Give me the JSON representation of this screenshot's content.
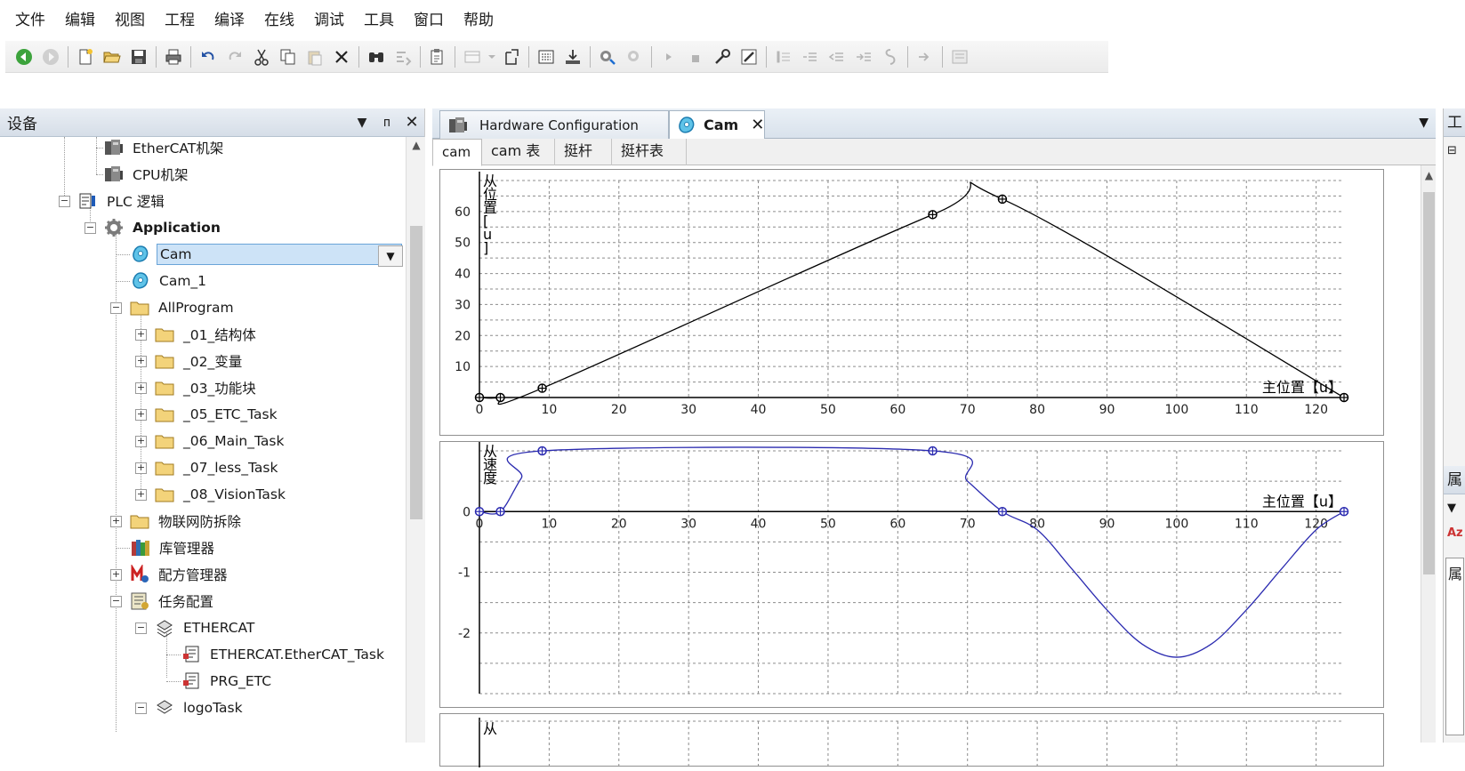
{
  "menu": [
    "文件",
    "编辑",
    "视图",
    "工程",
    "编译",
    "在线",
    "调试",
    "工具",
    "窗口",
    "帮助"
  ],
  "device_panel": {
    "title": "设备",
    "tree": [
      {
        "label": "EtherCAT机架",
        "icon": "rack-icon"
      },
      {
        "label": "CPU机架",
        "icon": "rack-icon"
      },
      {
        "label": "PLC 逻辑",
        "icon": "plc-logic-icon"
      },
      {
        "label": "Application",
        "icon": "application-gear-icon"
      },
      {
        "label": "Cam",
        "icon": "cam-icon"
      },
      {
        "label": "Cam_1",
        "icon": "cam-icon"
      },
      {
        "label": "AllProgram",
        "icon": "folder-icon"
      },
      {
        "label": "_01_结构体",
        "icon": "folder-icon"
      },
      {
        "label": "_02_变量",
        "icon": "folder-icon"
      },
      {
        "label": "_03_功能块",
        "icon": "folder-icon"
      },
      {
        "label": "_05_ETC_Task",
        "icon": "folder-icon"
      },
      {
        "label": "_06_Main_Task",
        "icon": "folder-icon"
      },
      {
        "label": "_07_less_Task",
        "icon": "folder-icon"
      },
      {
        "label": "_08_VisionTask",
        "icon": "folder-icon"
      },
      {
        "label": "物联网防拆除",
        "icon": "folder-icon"
      },
      {
        "label": "库管理器",
        "icon": "library-icon"
      },
      {
        "label": "配方管理器",
        "icon": "recipe-icon"
      },
      {
        "label": "任务配置",
        "icon": "task-config-icon"
      },
      {
        "label": "ETHERCAT",
        "icon": "task-icon"
      },
      {
        "label": "ETHERCAT.EtherCAT_Task",
        "icon": "program-call-icon"
      },
      {
        "label": "PRG_ETC",
        "icon": "program-call-icon"
      },
      {
        "label": "logoTask",
        "icon": "task-icon"
      }
    ]
  },
  "editor": {
    "tabs": [
      {
        "label": "Hardware Configuration",
        "active": false
      },
      {
        "label": "Cam",
        "active": true
      }
    ],
    "sub_tabs": [
      "cam",
      "cam 表",
      "挺杆",
      "挺杆表"
    ]
  },
  "right_strip": {
    "top_label": "工",
    "bottom_label": "属",
    "bottom_item": "属"
  },
  "chart_data": [
    {
      "type": "line",
      "title": "",
      "ylabel": "从位置[u]",
      "xlabel": "主位置【u】",
      "xlim": [
        0,
        124
      ],
      "ylim": [
        0,
        70
      ],
      "xticks": [
        0,
        10,
        20,
        30,
        40,
        50,
        60,
        70,
        80,
        90,
        100,
        110,
        120
      ],
      "yticks": [
        10,
        20,
        30,
        40,
        50,
        60
      ],
      "grid": true,
      "color": "#000000",
      "x": [
        0,
        3,
        9,
        65,
        75,
        124
      ],
      "y": [
        0,
        0,
        3,
        59,
        64,
        0
      ],
      "point_markers": [
        0,
        3,
        9,
        65,
        75,
        124
      ]
    },
    {
      "type": "line",
      "title": "",
      "ylabel": "从速度",
      "xlabel": "主位置【u】",
      "xlim": [
        0,
        124
      ],
      "ylim": [
        -3,
        1
      ],
      "xticks": [
        0,
        10,
        20,
        30,
        40,
        50,
        60,
        70,
        80,
        90,
        100,
        110,
        120
      ],
      "yticks": [
        0,
        -1,
        -2
      ],
      "grid": true,
      "color": "#2b2bb0",
      "x": [
        0,
        3,
        6,
        9,
        65,
        70,
        75,
        80,
        85,
        90,
        95,
        100,
        105,
        110,
        115,
        120,
        124
      ],
      "y": [
        0,
        0,
        0.55,
        1.0,
        1.0,
        0.5,
        0.0,
        -0.3,
        -0.95,
        -1.62,
        -2.18,
        -2.4,
        -2.18,
        -1.62,
        -0.95,
        -0.3,
        0.0
      ],
      "point_markers": [
        0,
        3,
        9,
        65,
        75,
        124
      ]
    },
    {
      "type": "line",
      "ylabel": "从"
    }
  ]
}
